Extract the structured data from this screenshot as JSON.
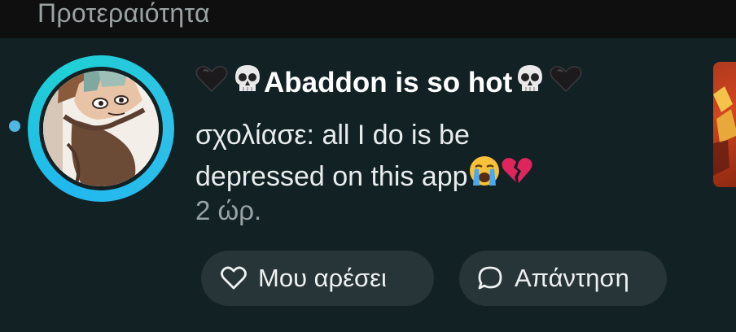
{
  "header": {
    "title": "Προτεραιότητα"
  },
  "notification": {
    "title_text": "Abaddon is so hot",
    "action": "σχολίασε: ",
    "comment_line1": "all I do is be",
    "comment_line2": "depressed on this app",
    "time": "2 ώρ.",
    "unread": true
  },
  "actions": {
    "like_label": "Μου αρέσει",
    "reply_label": "Απάντηση"
  },
  "icons": {
    "left_decoration": [
      "black-heart-icon",
      "skull-icon"
    ],
    "right_decoration": [
      "skull-icon",
      "black-heart-icon"
    ],
    "comment_end": [
      "crying-face-icon",
      "broken-heart-icon"
    ],
    "like": "heart-outline-icon",
    "reply": "speech-bubble-icon"
  },
  "colors": {
    "background": "#122124",
    "header_bg": "#0f0f10",
    "ring": "#21b8ef",
    "unread_dot": "#4fb7e4",
    "button_bg": "#283538"
  }
}
